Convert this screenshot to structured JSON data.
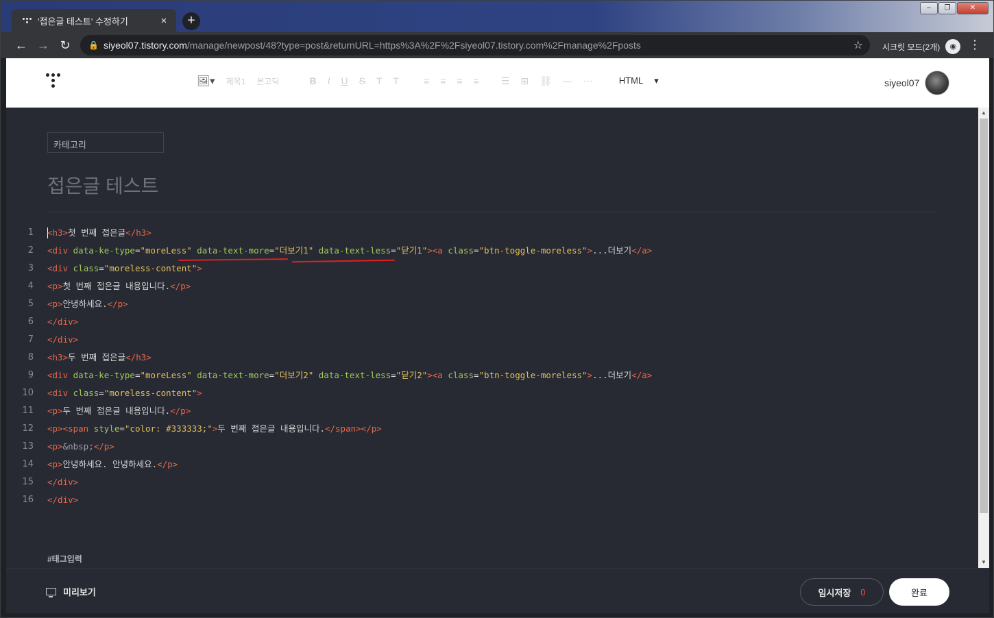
{
  "browser": {
    "tab_title": "'접은글 테스트' 수정하기",
    "tab_close": "×",
    "new_tab": "+",
    "url_domain": "siyeol07.tistory.com",
    "url_path": "/manage/newpost/48?type=post&returnURL=https%3A%2F%2Fsiyeol07.tistory.com%2Fmanage%2Fposts",
    "incognito_label": "시크릿 모드(2개)",
    "window_controls": [
      "–",
      "❐",
      "✕"
    ]
  },
  "editor_toolbar": {
    "heading_tool": "제목1",
    "font_tool": "본고딕",
    "format_tools": [
      "B",
      "I",
      "U",
      "S",
      "T",
      "T"
    ],
    "html_mode": "HTML"
  },
  "user": {
    "name": "siyeol07"
  },
  "post": {
    "category_placeholder": "카테고리",
    "title": "접은글 테스트",
    "tag_placeholder": "#태그입력"
  },
  "code_lines": [
    [
      [
        "t",
        "<h3>"
      ],
      [
        "x",
        "첫 번째 접은글"
      ],
      [
        "t",
        "</h3>"
      ]
    ],
    [
      [
        "t",
        "<div "
      ],
      [
        "a",
        "data-ke-type"
      ],
      [
        "x",
        "="
      ],
      [
        "v",
        "\"moreLess\""
      ],
      [
        "x",
        " "
      ],
      [
        "a",
        "data-text-more"
      ],
      [
        "x",
        "="
      ],
      [
        "v",
        "\"더보기1\""
      ],
      [
        "x",
        " "
      ],
      [
        "a",
        "data-text-less"
      ],
      [
        "x",
        "="
      ],
      [
        "v",
        "\"닫기1\""
      ],
      [
        "t",
        "><a "
      ],
      [
        "a",
        "class"
      ],
      [
        "x",
        "="
      ],
      [
        "v",
        "\"btn-toggle-moreless\""
      ],
      [
        "t",
        ">"
      ],
      [
        "x",
        "...더보기"
      ],
      [
        "t",
        "</a>"
      ]
    ],
    [
      [
        "t",
        "<div "
      ],
      [
        "a",
        "class"
      ],
      [
        "x",
        "="
      ],
      [
        "v",
        "\"moreless-content\""
      ],
      [
        "t",
        ">"
      ]
    ],
    [
      [
        "t",
        "<p>"
      ],
      [
        "x",
        "첫 번째 접은글 내용입니다."
      ],
      [
        "t",
        "</p>"
      ]
    ],
    [
      [
        "t",
        "<p>"
      ],
      [
        "x",
        "안녕하세요."
      ],
      [
        "t",
        "</p>"
      ]
    ],
    [
      [
        "t",
        "</div>"
      ]
    ],
    [
      [
        "t",
        "</div>"
      ]
    ],
    [
      [
        "t",
        "<h3>"
      ],
      [
        "x",
        "두 번째 접은글"
      ],
      [
        "t",
        "</h3>"
      ]
    ],
    [
      [
        "t",
        "<div "
      ],
      [
        "a",
        "data-ke-type"
      ],
      [
        "x",
        "="
      ],
      [
        "v",
        "\"moreLess\""
      ],
      [
        "x",
        " "
      ],
      [
        "a",
        "data-text-more"
      ],
      [
        "x",
        "="
      ],
      [
        "v",
        "\"더보기2\""
      ],
      [
        "x",
        " "
      ],
      [
        "a",
        "data-text-less"
      ],
      [
        "x",
        "="
      ],
      [
        "v",
        "\"닫기2\""
      ],
      [
        "t",
        "><a "
      ],
      [
        "a",
        "class"
      ],
      [
        "x",
        "="
      ],
      [
        "v",
        "\"btn-toggle-moreless\""
      ],
      [
        "t",
        ">"
      ],
      [
        "x",
        "...더보기"
      ],
      [
        "t",
        "</a>"
      ]
    ],
    [
      [
        "t",
        "<div "
      ],
      [
        "a",
        "class"
      ],
      [
        "x",
        "="
      ],
      [
        "v",
        "\"moreless-content\""
      ],
      [
        "t",
        ">"
      ]
    ],
    [
      [
        "t",
        "<p>"
      ],
      [
        "x",
        "두 번째 접은글 내용입니다."
      ],
      [
        "t",
        "</p>"
      ]
    ],
    [
      [
        "t",
        "<p><span "
      ],
      [
        "a",
        "style"
      ],
      [
        "x",
        "="
      ],
      [
        "v",
        "\"color: #333333;\""
      ],
      [
        "t",
        ">"
      ],
      [
        "x",
        "두 번째 접은글 내용입니다."
      ],
      [
        "t",
        "</span></p>"
      ]
    ],
    [
      [
        "t",
        "<p>"
      ],
      [
        "e",
        "&nbsp;"
      ],
      [
        "t",
        "</p>"
      ]
    ],
    [
      [
        "t",
        "<p>"
      ],
      [
        "x",
        "안녕하세요. 안녕하세요."
      ],
      [
        "t",
        "</p>"
      ]
    ],
    [
      [
        "t",
        "</div>"
      ]
    ],
    [
      [
        "t",
        "</div>"
      ]
    ]
  ],
  "footer": {
    "preview_label": "미리보기",
    "temp_save_label": "임시저장",
    "temp_save_count": "0",
    "done_label": "완료"
  },
  "colors": {
    "tag": "#e8684a",
    "attr": "#a2c95a",
    "value": "#e3c05a",
    "annotation": "#e02020"
  }
}
